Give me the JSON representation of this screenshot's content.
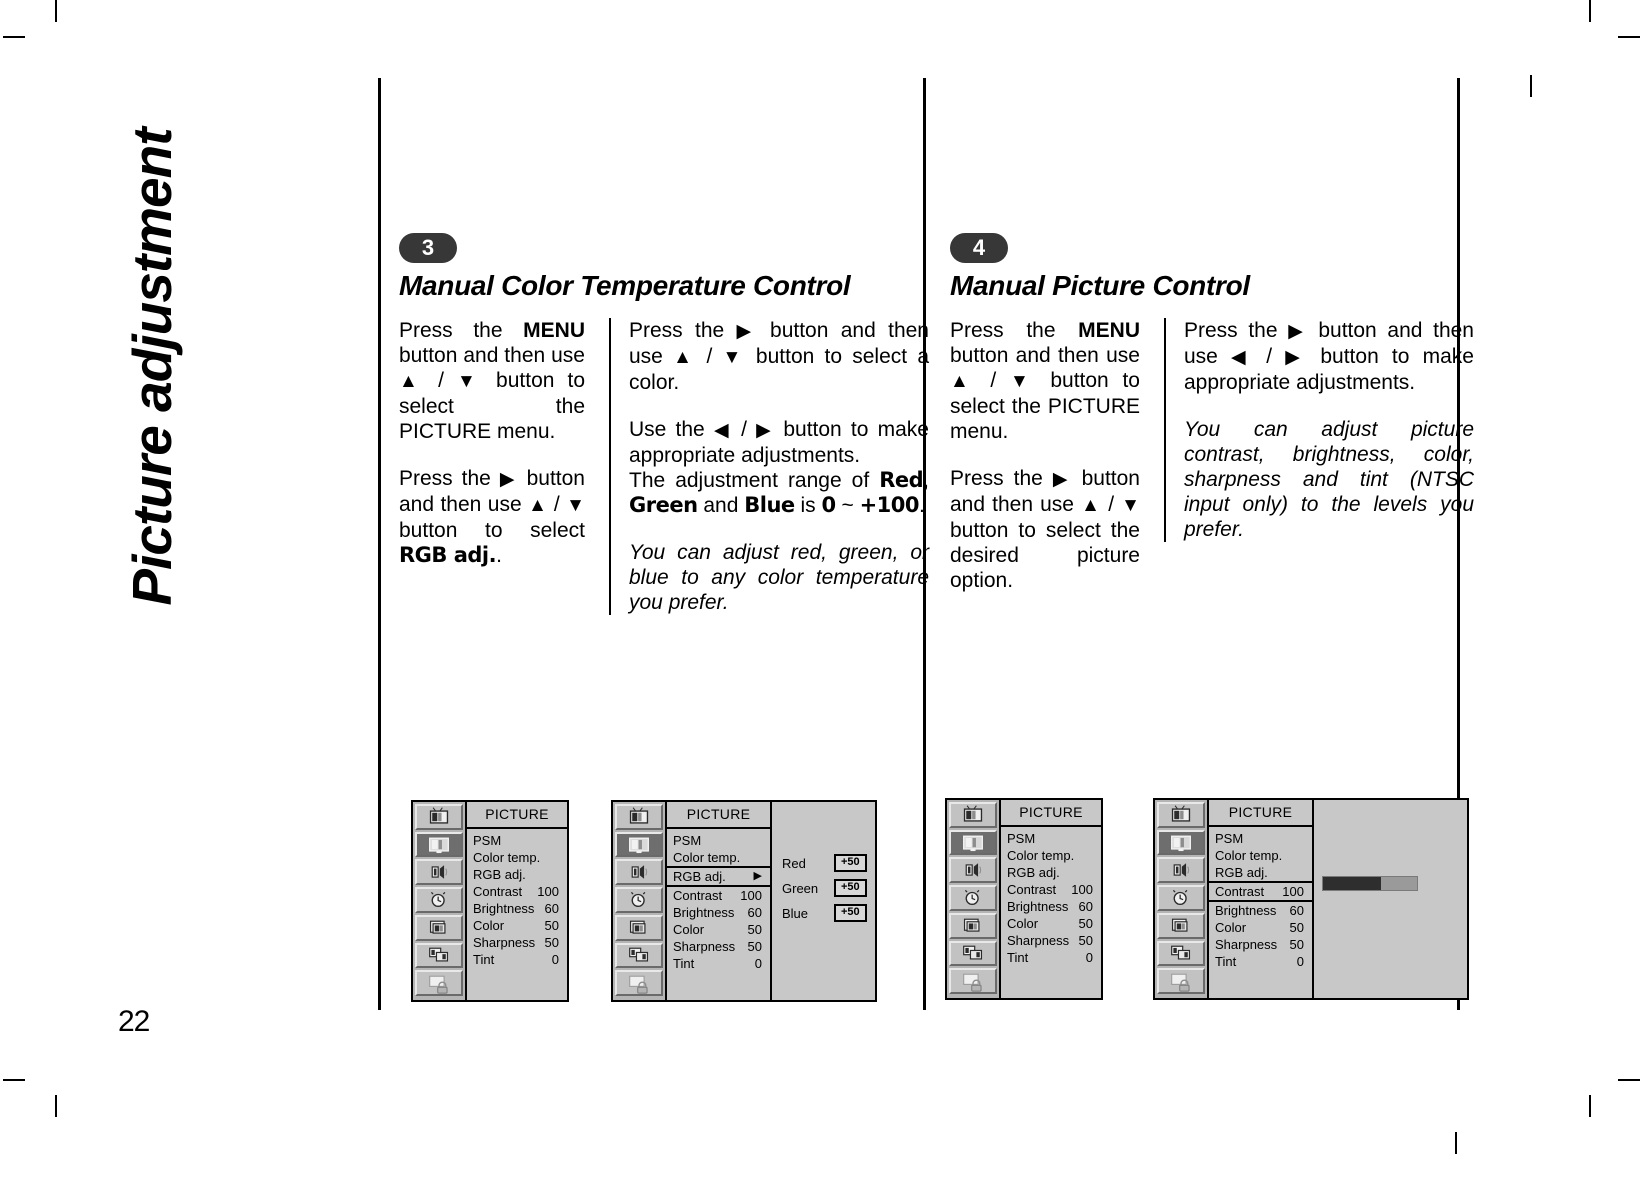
{
  "page": {
    "side_title": "Picture adjustment",
    "page_number": "22"
  },
  "sections": [
    {
      "badge": "3",
      "title": "Manual Color Temperature Control",
      "col_a": [
        "Press the MENU button and then use ▲ / ▼ button to select the PICTURE menu.",
        "Press the ▶ button and then use ▲ / ▼ button to select RGB adj.."
      ],
      "col_b": [
        "Press the ▶ button and then use ▲ / ▼ button to select a color.",
        "Use the ◀ / ▶ button to make appropriate adjustments. The adjustment range of Red, Green and Blue is 0 ~ +100.",
        "You can adjust red, green, or blue to any color temperature you prefer."
      ]
    },
    {
      "badge": "4",
      "title": "Manual Picture Control",
      "col_a": [
        "Press the MENU button and then use ▲ / ▼ button to select the PICTURE menu.",
        "Press the ▶ button and then use ▲ / ▼ button to select the desired picture option."
      ],
      "col_b": [
        "Press the ▶ button and then use ◀ / ▶ button to make appropriate adjustments.",
        "You can adjust picture contrast, brightness, color, sharpness and tint (NTSC input only) to the levels you prefer."
      ]
    }
  ],
  "osd": {
    "header": "PICTURE",
    "icons": [
      "tv-station-icon",
      "picture-tv-icon",
      "speaker-sound-icon",
      "clock-timer-icon",
      "special-feature-icon",
      "pip-screen-icon",
      "lock-screen-icon"
    ],
    "selected_icon_index": 1,
    "menu_items": [
      {
        "label": "PSM",
        "value": ""
      },
      {
        "label": "Color temp.",
        "value": ""
      },
      {
        "label": "RGB adj.",
        "value": ""
      },
      {
        "label": "Contrast",
        "value": "100"
      },
      {
        "label": "Brightness",
        "value": "60"
      },
      {
        "label": "Color",
        "value": "50"
      },
      {
        "label": "Sharpness",
        "value": "50"
      },
      {
        "label": "Tint",
        "value": "0"
      }
    ],
    "rgb_panel": {
      "caret": "▶",
      "rows": [
        {
          "label": "Red",
          "value": "+50"
        },
        {
          "label": "Green",
          "value": "+50"
        },
        {
          "label": "Blue",
          "value": "+50"
        }
      ]
    },
    "contrast_slider": {
      "label": "Contrast",
      "value": "100",
      "fill_percent": 62
    }
  },
  "screens": [
    {
      "name": "picture-menu-basic",
      "highlight_row": -1,
      "side": "none"
    },
    {
      "name": "rgb-adjust-menu",
      "highlight_row": 2,
      "side": "rgb"
    },
    {
      "name": "picture-menu-plain",
      "highlight_row": -1,
      "side": "none"
    },
    {
      "name": "contrast-adjust-menu",
      "highlight_row": 3,
      "side": "slider"
    }
  ]
}
